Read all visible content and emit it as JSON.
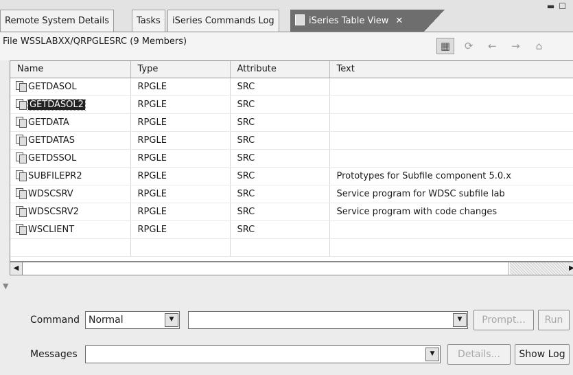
{
  "tabs": [
    {
      "label": "Remote System Details"
    },
    {
      "label": "Tasks"
    },
    {
      "label": "iSeries Commands Log"
    },
    {
      "label": "iSeries Table View"
    }
  ],
  "view": {
    "title": "File WSSLABXX/QRPGLESRC (9 Members)"
  },
  "table": {
    "columns": [
      "Name",
      "Type",
      "Attribute",
      "Text"
    ],
    "rows": [
      {
        "name": "GETDASOL",
        "type": "RPGLE",
        "attribute": "SRC",
        "text": ""
      },
      {
        "name": "GETDASOL2",
        "type": "RPGLE",
        "attribute": "SRC",
        "text": ""
      },
      {
        "name": "GETDATA",
        "type": "RPGLE",
        "attribute": "SRC",
        "text": ""
      },
      {
        "name": "GETDATAS",
        "type": "RPGLE",
        "attribute": "SRC",
        "text": ""
      },
      {
        "name": "GETDSSOL",
        "type": "RPGLE",
        "attribute": "SRC",
        "text": ""
      },
      {
        "name": "SUBFILEPR2",
        "type": "RPGLE",
        "attribute": "SRC",
        "text": "Prototypes for Subfile component 5.0.x"
      },
      {
        "name": "WDSCSRV",
        "type": "RPGLE",
        "attribute": "SRC",
        "text": "Service program for WDSC subfile lab"
      },
      {
        "name": "WDSCSRV2",
        "type": "RPGLE",
        "attribute": "SRC",
        "text": "Service program with code changes"
      },
      {
        "name": "WSCLIENT",
        "type": "RPGLE",
        "attribute": "SRC",
        "text": ""
      }
    ]
  },
  "command": {
    "label": "Command",
    "mode": "Normal",
    "value": "",
    "prompt_label": "Prompt...",
    "run_label": "Run"
  },
  "messages": {
    "label": "Messages",
    "value": "",
    "details_label": "Details...",
    "show_log_label": "Show Log"
  }
}
